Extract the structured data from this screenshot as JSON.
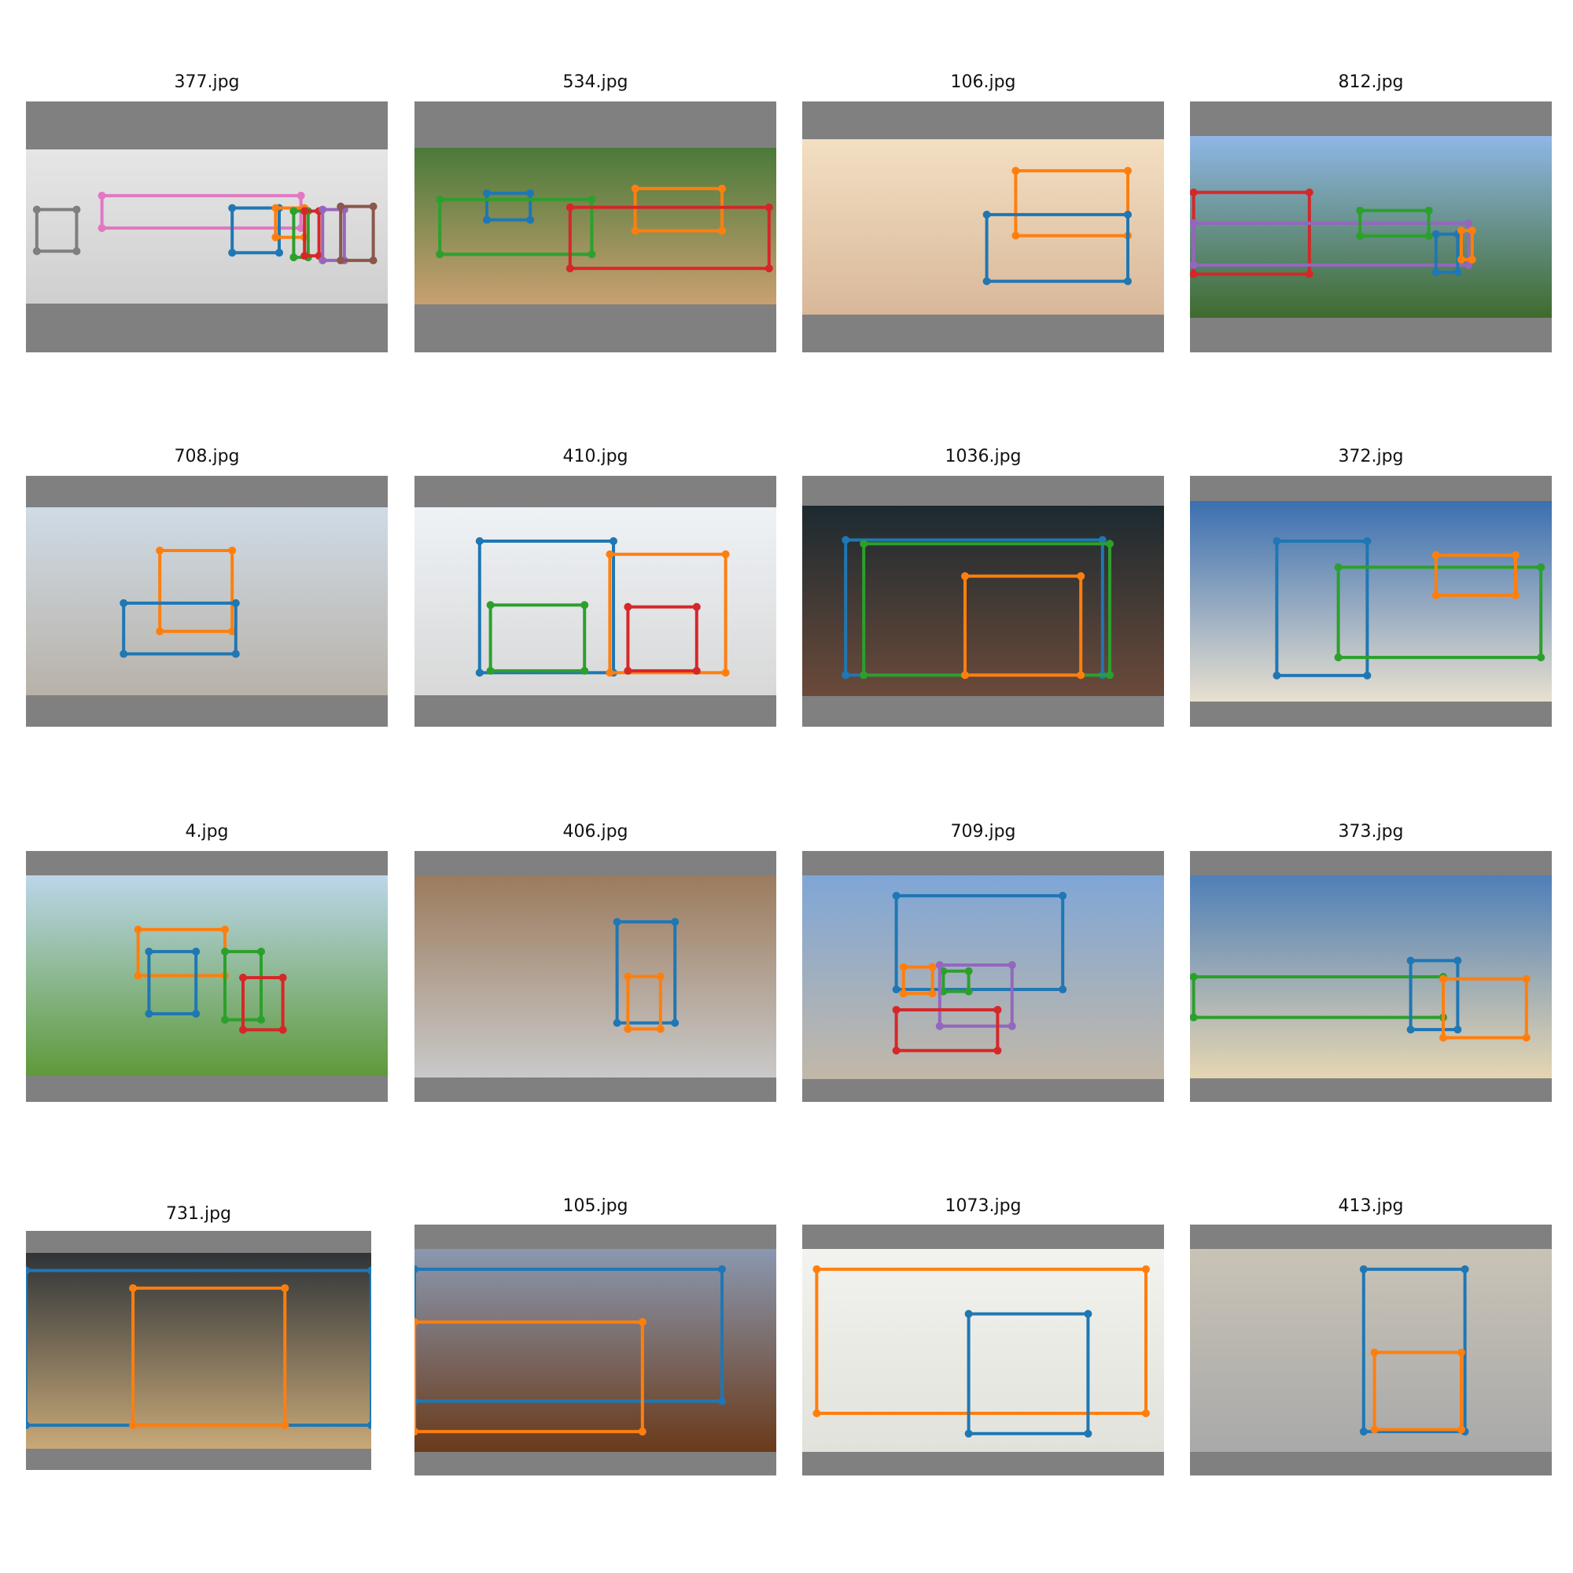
{
  "palette": {
    "blue": "#1f77b4",
    "orange": "#ff7f0e",
    "green": "#2ca02c",
    "red": "#d62728",
    "purple": "#9467bd",
    "brown": "#8c564b",
    "pink": "#e377c2",
    "gray": "#7f7f7f",
    "letterbox": "#808080"
  },
  "panels": [
    {
      "title": "377.jpg",
      "scene_colors": [
        "#e6e6e6",
        "#cfcfcf"
      ],
      "boxes": [
        {
          "c": "gray",
          "b": [
            0.03,
            0.39,
            0.14,
            0.66
          ]
        },
        {
          "c": "pink",
          "b": [
            0.21,
            0.3,
            0.76,
            0.51
          ]
        },
        {
          "c": "blue",
          "b": [
            0.57,
            0.38,
            0.7,
            0.67
          ]
        },
        {
          "c": "orange",
          "b": [
            0.69,
            0.38,
            0.77,
            0.57
          ]
        },
        {
          "c": "green",
          "b": [
            0.74,
            0.4,
            0.78,
            0.7
          ]
        },
        {
          "c": "red",
          "b": [
            0.77,
            0.4,
            0.81,
            0.69
          ]
        },
        {
          "c": "purple",
          "b": [
            0.82,
            0.39,
            0.88,
            0.72
          ]
        },
        {
          "c": "brown",
          "b": [
            0.87,
            0.37,
            0.96,
            0.72
          ]
        }
      ]
    },
    {
      "title": "534.jpg",
      "scene_colors": [
        "#4a7a3a",
        "#c9a070"
      ],
      "boxes": [
        {
          "c": "blue",
          "b": [
            0.2,
            0.29,
            0.32,
            0.46
          ]
        },
        {
          "c": "green",
          "b": [
            0.07,
            0.33,
            0.49,
            0.68
          ]
        },
        {
          "c": "orange",
          "b": [
            0.61,
            0.26,
            0.85,
            0.53
          ]
        },
        {
          "c": "red",
          "b": [
            0.43,
            0.38,
            0.98,
            0.77
          ]
        }
      ]
    },
    {
      "title": "106.jpg",
      "scene_colors": [
        "#f3dfc2",
        "#d9b89a"
      ],
      "boxes": [
        {
          "c": "orange",
          "b": [
            0.59,
            0.18,
            0.9,
            0.55
          ]
        },
        {
          "c": "blue",
          "b": [
            0.51,
            0.43,
            0.9,
            0.81
          ]
        }
      ]
    },
    {
      "title": "812.jpg",
      "scene_colors": [
        "#8fb7e6",
        "#3f6b2e"
      ],
      "boxes": [
        {
          "c": "red",
          "b": [
            0.01,
            0.31,
            0.33,
            0.76
          ]
        },
        {
          "c": "purple",
          "b": [
            0.01,
            0.48,
            0.77,
            0.71
          ]
        },
        {
          "c": "green",
          "b": [
            0.47,
            0.41,
            0.66,
            0.55
          ]
        },
        {
          "c": "blue",
          "b": [
            0.68,
            0.54,
            0.74,
            0.75
          ]
        },
        {
          "c": "orange",
          "b": [
            0.75,
            0.52,
            0.78,
            0.68
          ]
        }
      ]
    },
    {
      "title": "708.jpg",
      "scene_colors": [
        "#cfdbe6",
        "#b8b2a8"
      ],
      "boxes": [
        {
          "c": "orange",
          "b": [
            0.37,
            0.23,
            0.57,
            0.66
          ]
        },
        {
          "c": "blue",
          "b": [
            0.27,
            0.51,
            0.58,
            0.78
          ]
        }
      ]
    },
    {
      "title": "410.jpg",
      "scene_colors": [
        "#eef2f6",
        "#d8d8d8"
      ],
      "boxes": [
        {
          "c": "blue",
          "b": [
            0.18,
            0.18,
            0.55,
            0.88
          ]
        },
        {
          "c": "orange",
          "b": [
            0.54,
            0.25,
            0.86,
            0.88
          ]
        },
        {
          "c": "green",
          "b": [
            0.21,
            0.52,
            0.47,
            0.87
          ]
        },
        {
          "c": "red",
          "b": [
            0.59,
            0.53,
            0.78,
            0.87
          ]
        }
      ]
    },
    {
      "title": "1036.jpg",
      "scene_colors": [
        "#1c2a30",
        "#6b4a3a"
      ],
      "boxes": [
        {
          "c": "blue",
          "b": [
            0.12,
            0.18,
            0.83,
            0.89
          ]
        },
        {
          "c": "green",
          "b": [
            0.17,
            0.2,
            0.85,
            0.89
          ]
        },
        {
          "c": "orange",
          "b": [
            0.45,
            0.37,
            0.77,
            0.89
          ]
        }
      ]
    },
    {
      "title": "372.jpg",
      "scene_colors": [
        "#3b6fb0",
        "#e8e0d0"
      ],
      "boxes": [
        {
          "c": "blue",
          "b": [
            0.24,
            0.2,
            0.49,
            0.87
          ]
        },
        {
          "c": "green",
          "b": [
            0.41,
            0.33,
            0.97,
            0.78
          ]
        },
        {
          "c": "orange",
          "b": [
            0.68,
            0.27,
            0.9,
            0.47
          ]
        }
      ]
    },
    {
      "title": "4.jpg",
      "scene_colors": [
        "#bcd6ea",
        "#5e9a3a"
      ],
      "boxes": [
        {
          "c": "orange",
          "b": [
            0.31,
            0.27,
            0.55,
            0.5
          ]
        },
        {
          "c": "blue",
          "b": [
            0.34,
            0.38,
            0.47,
            0.69
          ]
        },
        {
          "c": "green",
          "b": [
            0.55,
            0.38,
            0.65,
            0.72
          ]
        },
        {
          "c": "red",
          "b": [
            0.6,
            0.51,
            0.71,
            0.77
          ]
        }
      ]
    },
    {
      "title": "406.jpg",
      "scene_colors": [
        "#9c7b5e",
        "#c9c9c9"
      ],
      "boxes": [
        {
          "c": "blue",
          "b": [
            0.56,
            0.23,
            0.72,
            0.73
          ]
        },
        {
          "c": "orange",
          "b": [
            0.59,
            0.5,
            0.68,
            0.76
          ]
        }
      ]
    },
    {
      "title": "709.jpg",
      "scene_colors": [
        "#7fa6d6",
        "#c2b8a8"
      ],
      "boxes": [
        {
          "c": "blue",
          "b": [
            0.26,
            0.1,
            0.72,
            0.56
          ]
        },
        {
          "c": "orange",
          "b": [
            0.28,
            0.45,
            0.36,
            0.58
          ]
        },
        {
          "c": "green",
          "b": [
            0.39,
            0.47,
            0.46,
            0.57
          ]
        },
        {
          "c": "purple",
          "b": [
            0.38,
            0.44,
            0.58,
            0.74
          ]
        },
        {
          "c": "red",
          "b": [
            0.26,
            0.66,
            0.54,
            0.86
          ]
        }
      ]
    },
    {
      "title": "373.jpg",
      "scene_colors": [
        "#4f7fb8",
        "#e6d6b2"
      ],
      "boxes": [
        {
          "c": "green",
          "b": [
            0.01,
            0.5,
            0.7,
            0.7
          ]
        },
        {
          "c": "blue",
          "b": [
            0.61,
            0.42,
            0.74,
            0.76
          ]
        },
        {
          "c": "orange",
          "b": [
            0.7,
            0.51,
            0.93,
            0.8
          ]
        }
      ]
    },
    {
      "title": "731.jpg",
      "scene_colors": [
        "#2f3438",
        "#c8a878"
      ],
      "boxes": [
        {
          "c": "blue",
          "b": [
            0.0,
            0.09,
            1.0,
            0.88
          ]
        },
        {
          "c": "orange",
          "b": [
            0.31,
            0.18,
            0.75,
            0.88
          ]
        }
      ]
    },
    {
      "title": "105.jpg",
      "scene_colors": [
        "#8a98b0",
        "#6a3a1a"
      ],
      "boxes": [
        {
          "c": "blue",
          "b": [
            0.0,
            0.1,
            0.85,
            0.75
          ]
        },
        {
          "c": "orange",
          "b": [
            0.0,
            0.36,
            0.63,
            0.9
          ]
        }
      ]
    },
    {
      "title": "1073.jpg",
      "scene_colors": [
        "#f2f2ee",
        "#e2e2dc"
      ],
      "boxes": [
        {
          "c": "orange",
          "b": [
            0.04,
            0.1,
            0.95,
            0.81
          ]
        },
        {
          "c": "blue",
          "b": [
            0.46,
            0.32,
            0.79,
            0.91
          ]
        }
      ]
    },
    {
      "title": "413.jpg",
      "scene_colors": [
        "#c9c3b6",
        "#a9a9a9"
      ],
      "boxes": [
        {
          "c": "blue",
          "b": [
            0.48,
            0.1,
            0.76,
            0.9
          ]
        },
        {
          "c": "orange",
          "b": [
            0.51,
            0.51,
            0.75,
            0.89
          ]
        }
      ]
    }
  ]
}
